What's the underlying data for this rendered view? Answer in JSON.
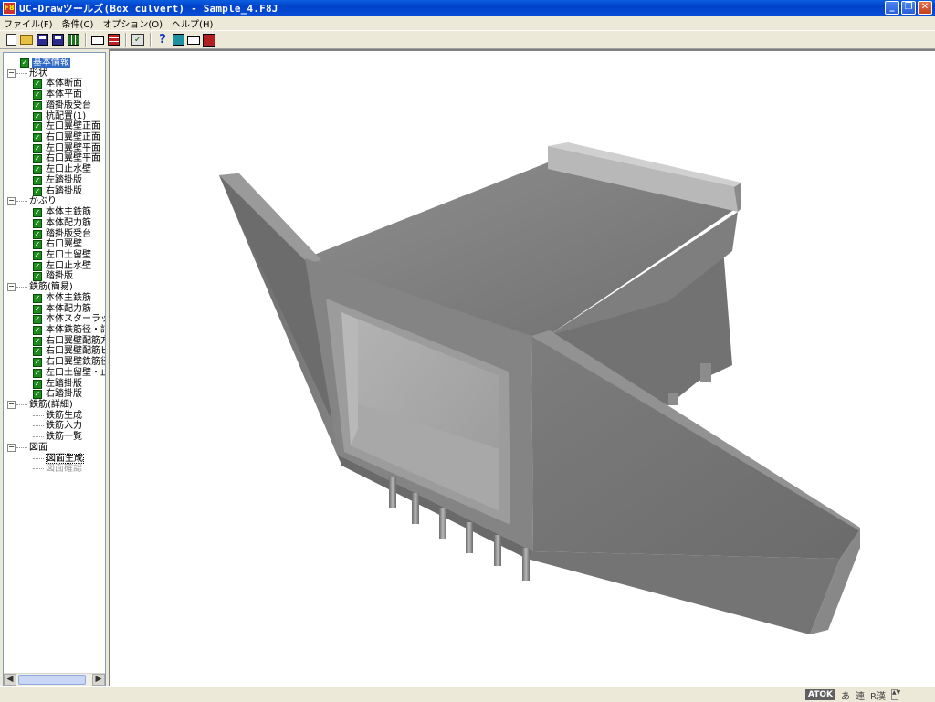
{
  "window": {
    "title": "UC-Drawツールズ(Box culvert) - Sample_4.F8J",
    "app_icon": "F8",
    "buttons": {
      "minimize": "_",
      "maximize": "❐",
      "close": "✕"
    }
  },
  "menu": [
    "ファイル(F)",
    "条件(C)",
    "オプション(O)",
    "ヘルプ(H)"
  ],
  "toolbar": {
    "icons": [
      "new-file-icon",
      "open-folder-icon",
      "save-icon",
      "save-as-icon",
      "grid-icon",
      "chart-window-icon",
      "table-icon",
      "check-edit-icon",
      "help-icon",
      "view-icon",
      "card-icon",
      "exit-icon"
    ]
  },
  "tree": [
    {
      "level": 0,
      "type": "check",
      "label": "基本情報",
      "selected": true
    },
    {
      "level": 0,
      "type": "expand",
      "label": "形状"
    },
    {
      "level": 1,
      "type": "check",
      "label": "本体断面"
    },
    {
      "level": 1,
      "type": "check",
      "label": "本体平面"
    },
    {
      "level": 1,
      "type": "check",
      "label": "踏掛版受台"
    },
    {
      "level": 1,
      "type": "check",
      "label": "杭配置(1)"
    },
    {
      "level": 1,
      "type": "check",
      "label": "左口翼壁正面"
    },
    {
      "level": 1,
      "type": "check",
      "label": "右口翼壁正面"
    },
    {
      "level": 1,
      "type": "check",
      "label": "左口翼壁平面"
    },
    {
      "level": 1,
      "type": "check",
      "label": "右口翼壁平面"
    },
    {
      "level": 1,
      "type": "check",
      "label": "左口止水壁"
    },
    {
      "level": 1,
      "type": "check",
      "label": "左踏掛版"
    },
    {
      "level": 1,
      "type": "check",
      "label": "右踏掛版"
    },
    {
      "level": 0,
      "type": "expand",
      "label": "かぶり"
    },
    {
      "level": 1,
      "type": "check",
      "label": "本体主鉄筋"
    },
    {
      "level": 1,
      "type": "check",
      "label": "本体配力筋"
    },
    {
      "level": 1,
      "type": "check",
      "label": "踏掛版受台"
    },
    {
      "level": 1,
      "type": "check",
      "label": "右口翼壁"
    },
    {
      "level": 1,
      "type": "check",
      "label": "左口土留壁"
    },
    {
      "level": 1,
      "type": "check",
      "label": "左口止水壁"
    },
    {
      "level": 1,
      "type": "check",
      "label": "踏掛版"
    },
    {
      "level": 0,
      "type": "expand",
      "label": "鉄筋(簡易)"
    },
    {
      "level": 1,
      "type": "check",
      "label": "本体主鉄筋"
    },
    {
      "level": 1,
      "type": "check",
      "label": "本体配力筋"
    },
    {
      "level": 1,
      "type": "check",
      "label": "本体スターラップ"
    },
    {
      "level": 1,
      "type": "check",
      "label": "本体鉄筋径・記号"
    },
    {
      "level": 1,
      "type": "check",
      "label": "右口翼壁配筋方法"
    },
    {
      "level": 1,
      "type": "check",
      "label": "右口翼壁配筋ピッチ"
    },
    {
      "level": 1,
      "type": "check",
      "label": "右口翼壁鉄筋径・記"
    },
    {
      "level": 1,
      "type": "check",
      "label": "左口土留壁・止水壁"
    },
    {
      "level": 1,
      "type": "check",
      "label": "左踏掛版"
    },
    {
      "level": 1,
      "type": "check",
      "label": "右踏掛版"
    },
    {
      "level": 0,
      "type": "expand",
      "label": "鉄筋(詳細)"
    },
    {
      "level": 1,
      "type": "plain",
      "label": "鉄筋生成"
    },
    {
      "level": 1,
      "type": "plain",
      "label": "鉄筋入力"
    },
    {
      "level": 1,
      "type": "plain",
      "label": "鉄筋一覧"
    },
    {
      "level": 0,
      "type": "expand",
      "label": "図面"
    },
    {
      "level": 1,
      "type": "plain",
      "label": "図面生成",
      "boxed": true
    },
    {
      "level": 1,
      "type": "plain",
      "label": "図面確認",
      "disabled": true
    }
  ],
  "statusbar": {
    "ime_logo": "ATOK",
    "ime_items": [
      "あ",
      "連",
      "R漢"
    ]
  },
  "colors": {
    "tree_check": "#1a8c1a",
    "selection": "#316ac5",
    "model_gray": "#7a7a7a"
  }
}
